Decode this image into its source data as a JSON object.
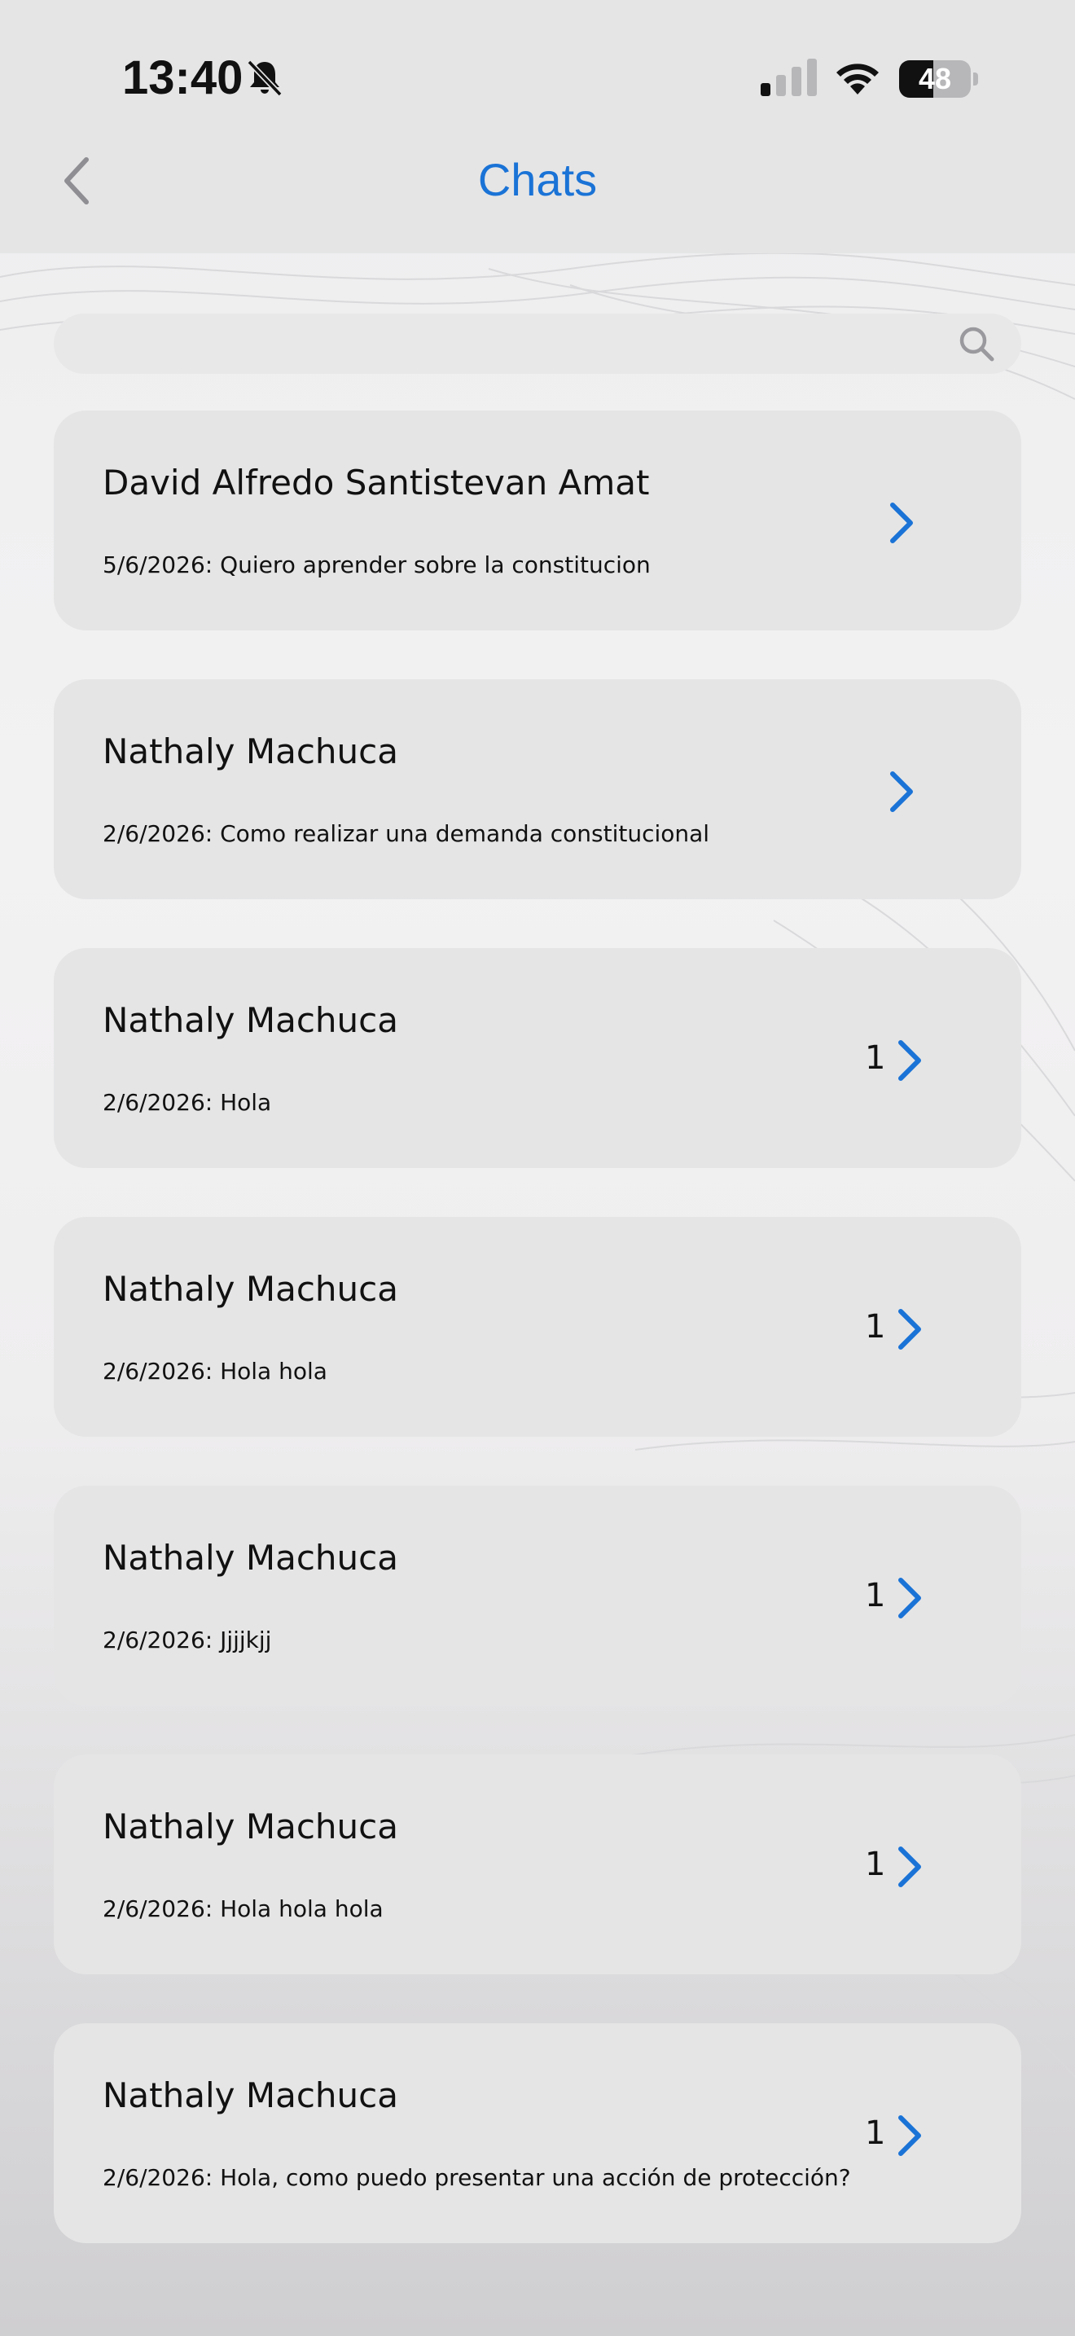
{
  "status_bar": {
    "time": "13:40",
    "battery": "48",
    "battery_level": 0.48
  },
  "header": {
    "title": "Chats",
    "back_icon": "chevron-left-icon"
  },
  "search": {
    "value": "",
    "icon": "search-icon"
  },
  "colors": {
    "accent": "#1a73d6",
    "card": "#e5e5e6",
    "header": "#e5e5e6"
  },
  "chats": [
    {
      "name": "David Alfredo Santistevan Amat",
      "preview": "5/6/2026: Quiero aprender sobre la constitucion",
      "unread": ""
    },
    {
      "name": "Nathaly Machuca",
      "preview": "2/6/2026: Como realizar una demanda constitucional",
      "unread": ""
    },
    {
      "name": "Nathaly Machuca",
      "preview": "2/6/2026: Hola",
      "unread": "1"
    },
    {
      "name": "Nathaly Machuca",
      "preview": "2/6/2026: Hola hola",
      "unread": "1"
    },
    {
      "name": "Nathaly Machuca",
      "preview": "2/6/2026: Jjjjkjj",
      "unread": "1"
    },
    {
      "name": "Nathaly Machuca",
      "preview": "2/6/2026: Hola hola hola",
      "unread": "1"
    },
    {
      "name": "Nathaly Machuca",
      "preview": "2/6/2026: Hola, como puedo presentar una acción de protección?",
      "unread": "1"
    }
  ]
}
